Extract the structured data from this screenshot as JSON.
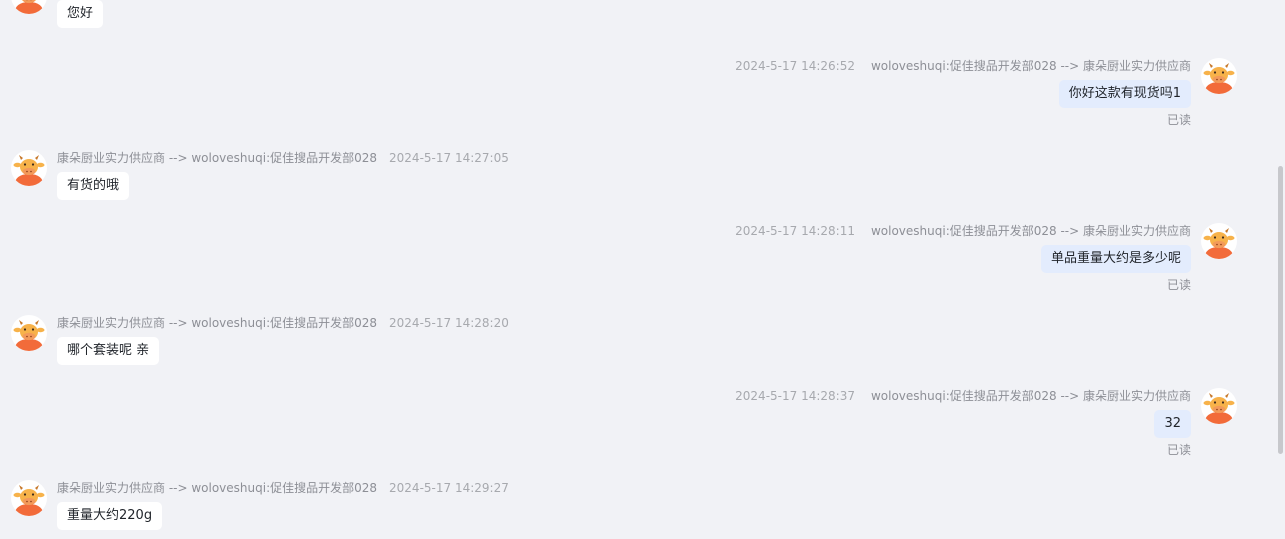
{
  "messages": [
    {
      "side": "left",
      "text": "您好"
    },
    {
      "side": "right",
      "time": "2024-5-17 14:26:52",
      "from_to": "woloveshuqi:促佳搜品开发部028 --> 康朵厨业实力供应商",
      "text": "你好这款有现货吗1",
      "status": "已读"
    },
    {
      "side": "left",
      "time": "2024-5-17 14:27:05",
      "from_to": "康朵厨业实力供应商 --> woloveshuqi:促佳搜品开发部028",
      "text": "有货的哦"
    },
    {
      "side": "right",
      "time": "2024-5-17 14:28:11",
      "from_to": "woloveshuqi:促佳搜品开发部028 --> 康朵厨业实力供应商",
      "text": "单品重量大约是多少呢",
      "status": "已读"
    },
    {
      "side": "left",
      "time": "2024-5-17 14:28:20",
      "from_to": "康朵厨业实力供应商 --> woloveshuqi:促佳搜品开发部028",
      "text": "哪个套装呢 亲"
    },
    {
      "side": "right",
      "time": "2024-5-17 14:28:37",
      "from_to": "woloveshuqi:促佳搜品开发部028 --> 康朵厨业实力供应商",
      "text": "32",
      "status": "已读"
    },
    {
      "side": "left",
      "time": "2024-5-17 14:29:27",
      "from_to": "康朵厨业实力供应商 --> woloveshuqi:促佳搜品开发部028",
      "text": "重量大约220g"
    }
  ],
  "colors": {
    "background": "#f1f2f6",
    "incoming_bubble": "#ffffff",
    "outgoing_bubble": "#e3ecfd",
    "avatar_orange": "#f26b3a",
    "avatar_face": "#f7b24a"
  },
  "icons": {
    "avatar": "cartoon-cow-avatar-icon"
  }
}
